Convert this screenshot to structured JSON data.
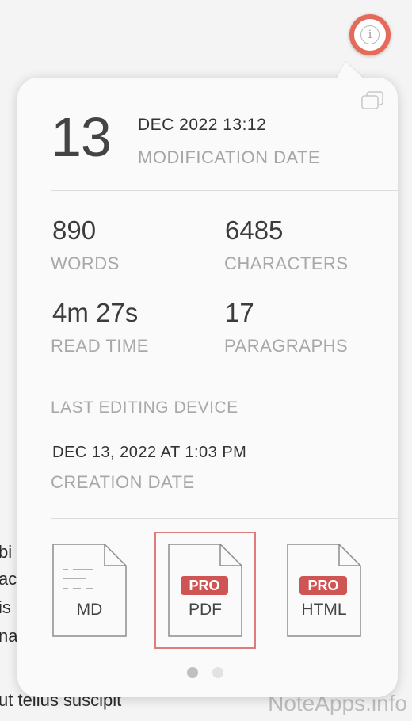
{
  "background_text": [
    "bi",
    "ac",
    "is",
    "na",
    "ut tellus suscipit"
  ],
  "watermark": "NoteApps.info",
  "info_button": {
    "icon": "info-icon",
    "glyph": "i",
    "accent": "#e66a5a"
  },
  "modification": {
    "day": "13",
    "date_time": "DEC 2022 13:12",
    "label": "MODIFICATION DATE"
  },
  "stats": {
    "words": {
      "value": "890",
      "label": "WORDS"
    },
    "characters": {
      "value": "6485",
      "label": "CHARACTERS"
    },
    "read_time": {
      "value": "4m 27s",
      "label": "READ TIME"
    },
    "paragraphs": {
      "value": "17",
      "label": "PARAGRAPHS"
    }
  },
  "device": {
    "label": "LAST EDITING DEVICE"
  },
  "creation": {
    "value": "DEC 13, 2022 AT 1:03 PM",
    "label": "CREATION DATE"
  },
  "exports": [
    {
      "format": "MD",
      "pro": false
    },
    {
      "format": "PDF",
      "pro": true,
      "selected": true
    },
    {
      "format": "HTML",
      "pro": true
    }
  ],
  "pro_badge": "PRO",
  "pro_color": "#cf5555",
  "pagination": {
    "current": 1,
    "total": 2
  }
}
